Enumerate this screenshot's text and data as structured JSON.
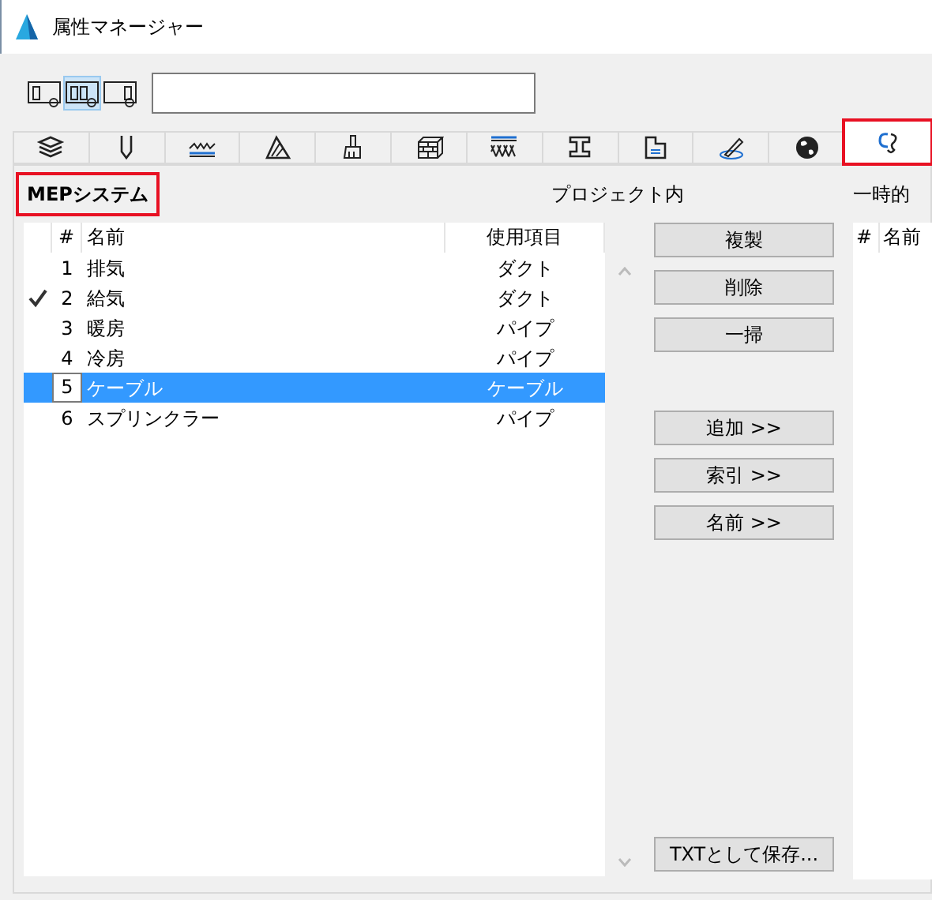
{
  "window": {
    "title": "属性マネージャー"
  },
  "view_buttons": [
    {
      "selected": false
    },
    {
      "selected": true
    },
    {
      "selected": false
    }
  ],
  "tabs": [
    {
      "selected": false,
      "highlighted": false
    },
    {
      "selected": false,
      "highlighted": false
    },
    {
      "selected": false,
      "highlighted": false
    },
    {
      "selected": false,
      "highlighted": false
    },
    {
      "selected": false,
      "highlighted": false
    },
    {
      "selected": false,
      "highlighted": false
    },
    {
      "selected": false,
      "highlighted": false
    },
    {
      "selected": false,
      "highlighted": false
    },
    {
      "selected": false,
      "highlighted": false
    },
    {
      "selected": false,
      "highlighted": false
    },
    {
      "selected": false,
      "highlighted": false
    },
    {
      "selected": true,
      "highlighted": true
    }
  ],
  "project_panel": {
    "heading": "MEPシステム",
    "heading_highlighted": true,
    "title": "プロジェクト内",
    "columns": [
      "#",
      "名前",
      "使用項目"
    ],
    "rows": [
      {
        "num": "1",
        "name": "排気",
        "usage": "ダクト",
        "checked": false,
        "selected": false
      },
      {
        "num": "2",
        "name": "給気",
        "usage": "ダクト",
        "checked": true,
        "selected": false
      },
      {
        "num": "3",
        "name": "暖房",
        "usage": "パイプ",
        "checked": false,
        "selected": false
      },
      {
        "num": "4",
        "name": "冷房",
        "usage": "パイプ",
        "checked": false,
        "selected": false
      },
      {
        "num": "5",
        "name": "ケーブル",
        "usage": "ケーブル",
        "checked": false,
        "selected": true
      },
      {
        "num": "6",
        "name": "スプリンクラー",
        "usage": "パイプ",
        "checked": false,
        "selected": false
      }
    ]
  },
  "buttons_top": [
    "複製",
    "削除",
    "一掃"
  ],
  "buttons_mid": [
    "追加 >>",
    "索引 >>",
    "名前 >>"
  ],
  "save_button": "TXTとして保存...",
  "temp_panel": {
    "title": "一時的",
    "columns": [
      "#",
      "名前"
    ]
  }
}
